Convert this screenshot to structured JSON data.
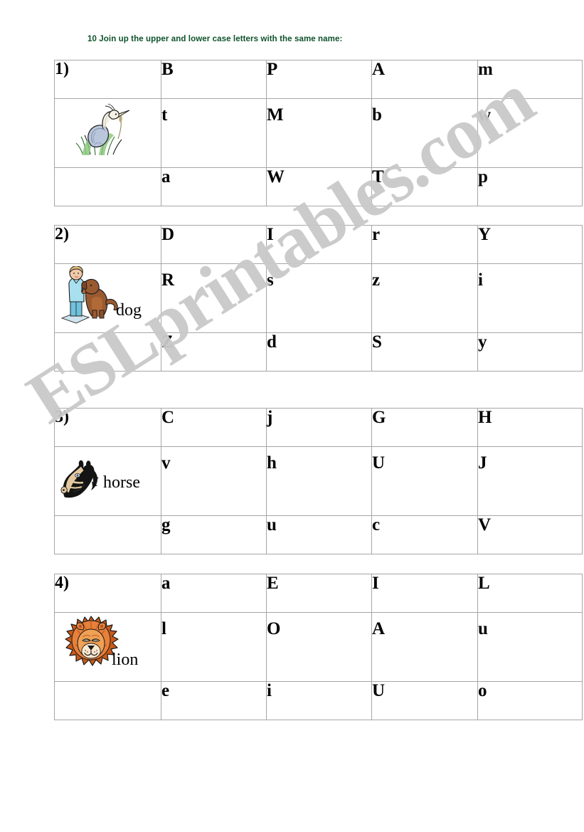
{
  "worksheet": {
    "title": "10 Join up the upper and lower case letters with the same name:",
    "title_color": "#0d5229",
    "watermark": "ESLprintables.com",
    "watermark_color": "#c9c9c9"
  },
  "exercises": [
    {
      "number": "1)",
      "picture": "heron-bird-clipart",
      "word": "",
      "rows": [
        [
          "B",
          "P",
          "A",
          "m"
        ],
        [
          "t",
          "M",
          "b",
          "w"
        ],
        [
          "a",
          "W",
          "T",
          "p"
        ]
      ]
    },
    {
      "number": "2)",
      "picture": "child-with-dog-clipart",
      "word": "dog",
      "rows": [
        [
          "D",
          "I",
          "r",
          "Y"
        ],
        [
          "R",
          "s",
          "z",
          "i"
        ],
        [
          "Z",
          "d",
          "S",
          "y"
        ]
      ]
    },
    {
      "number": "3)",
      "picture": "horse-head-clipart",
      "word": "horse",
      "rows": [
        [
          "C",
          "j",
          "G",
          "H"
        ],
        [
          "v",
          "h",
          "U",
          "J"
        ],
        [
          "g",
          "u",
          "c",
          "V"
        ]
      ]
    },
    {
      "number": "4)",
      "picture": "lion-head-clipart",
      "word": "lion",
      "rows": [
        [
          "a",
          "E",
          "I",
          "L"
        ],
        [
          "l",
          "O",
          "A",
          "u"
        ],
        [
          "e",
          "i",
          "U",
          "o"
        ]
      ]
    }
  ]
}
